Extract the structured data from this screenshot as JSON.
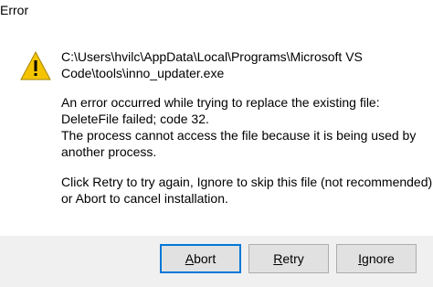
{
  "window": {
    "title": "Error"
  },
  "icon": {
    "name": "warning-icon",
    "color": "#f5c400"
  },
  "message": {
    "path_line_1": "C:\\Users\\hvilc\\AppData\\Local\\Programs\\Microsoft VS",
    "path_line_2": "Code\\tools\\inno_updater.exe",
    "error_line_1": "An error occurred while trying to replace the existing file:",
    "error_line_2": "DeleteFile failed; code 32.",
    "error_line_3": "The process cannot access the file because it is being used by",
    "error_line_4": "another process.",
    "instruction_line_1": "Click Retry to try again, Ignore to skip this file (not recommended),",
    "instruction_line_2": "or Abort to cancel installation."
  },
  "buttons": {
    "abort": {
      "accel": "A",
      "rest": "bort"
    },
    "retry": {
      "accel": "R",
      "rest": "etry"
    },
    "ignore": {
      "accel": "I",
      "rest": "gnore"
    }
  },
  "colors": {
    "footer_bg": "#f0f0f0",
    "default_button_border": "#0078d7",
    "button_bg": "#e1e1e1"
  }
}
